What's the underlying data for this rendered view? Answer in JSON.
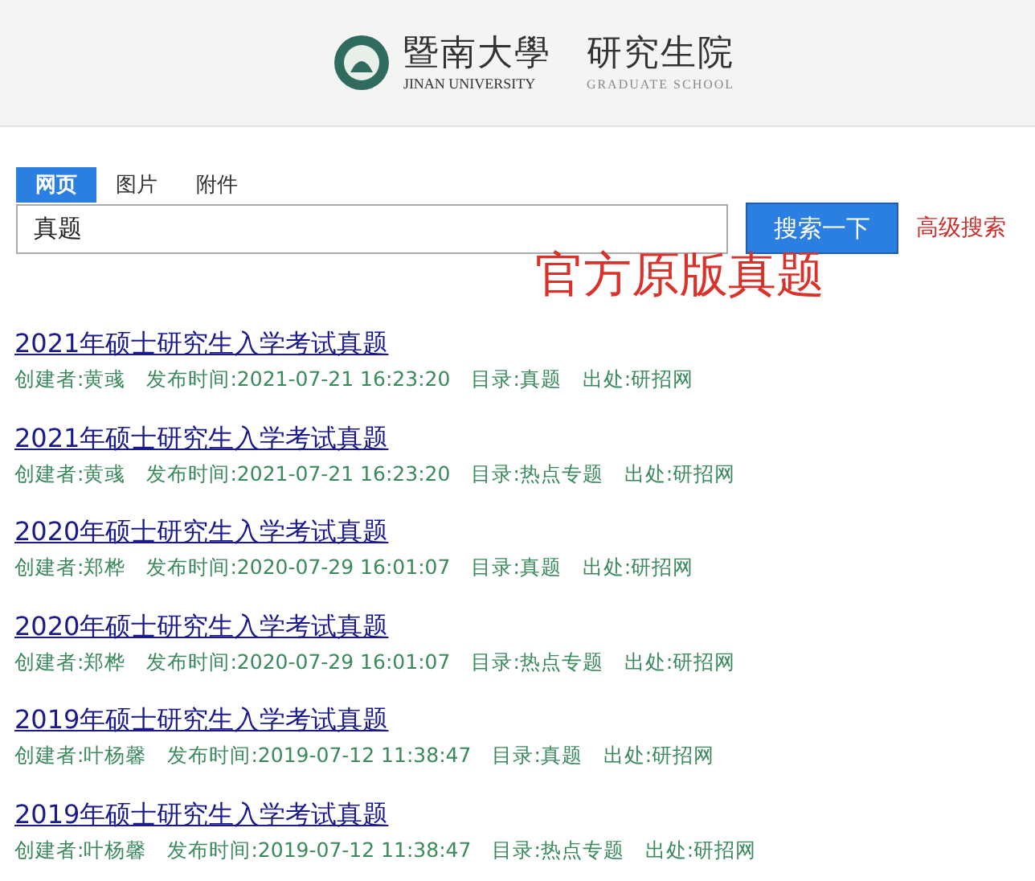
{
  "header": {
    "logo_cn": "暨南大學",
    "logo_en": "JINAN UNIVERSITY",
    "school_cn": "研究生院",
    "school_en": "GRADUATE SCHOOL"
  },
  "tabs": [
    {
      "label": "网页",
      "selected": true
    },
    {
      "label": "图片",
      "selected": false
    },
    {
      "label": "附件",
      "selected": false
    }
  ],
  "search": {
    "value": "真题",
    "button": "搜索一下",
    "advanced": "高级搜索"
  },
  "annotation": "官方原版真题",
  "results": [
    {
      "title": "2021年硕士研究生入学考试真题",
      "creator": "创建者:黄彧",
      "time": "发布时间:2021-07-21 16:23:20",
      "catalog": "目录:真题",
      "source": "出处:研招网"
    },
    {
      "title": "2021年硕士研究生入学考试真题",
      "creator": "创建者:黄彧",
      "time": "发布时间:2021-07-21 16:23:20",
      "catalog": "目录:热点专题",
      "source": "出处:研招网"
    },
    {
      "title": "2020年硕士研究生入学考试真题",
      "creator": "创建者:郑桦",
      "time": "发布时间:2020-07-29 16:01:07",
      "catalog": "目录:真题",
      "source": "出处:研招网"
    },
    {
      "title": "2020年硕士研究生入学考试真题",
      "creator": "创建者:郑桦",
      "time": "发布时间:2020-07-29 16:01:07",
      "catalog": "目录:热点专题",
      "source": "出处:研招网"
    },
    {
      "title": "2019年硕士研究生入学考试真题",
      "creator": "创建者:叶杨馨",
      "time": "发布时间:2019-07-12 11:38:47",
      "catalog": "目录:真题",
      "source": "出处:研招网"
    },
    {
      "title": "2019年硕士研究生入学考试真题",
      "creator": "创建者:叶杨馨",
      "time": "发布时间:2019-07-12 11:38:47",
      "catalog": "目录:热点专题",
      "source": "出处:研招网"
    }
  ]
}
